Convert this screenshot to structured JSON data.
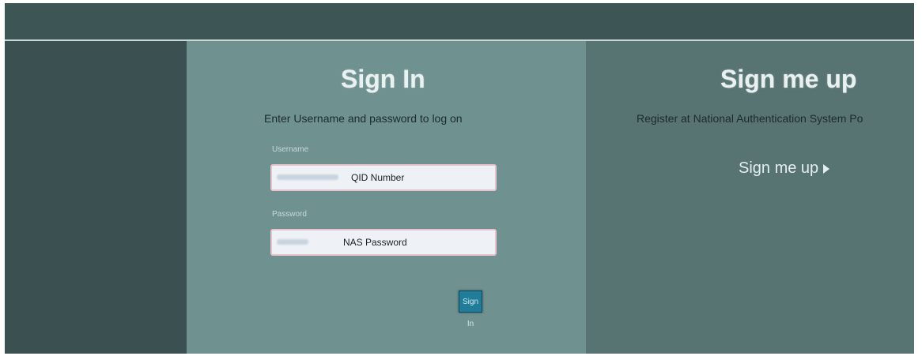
{
  "colors": {
    "dark_bg": "#3e5556",
    "signin_panel": "#6f9190",
    "signup_panel": "#577473",
    "button": "#1f7d9a"
  },
  "signin": {
    "title": "Sign In",
    "subtitle": "Enter Username and password to log on",
    "username_label": "Username",
    "username_placeholder": "QID Number",
    "password_label": "Password",
    "password_placeholder": "NAS Password",
    "button_label": "Sign In"
  },
  "signup": {
    "title": "Sign me up",
    "subtitle": "Register at National Authentication System Po",
    "link_label": "Sign me up",
    "link_icon": "arrow-right-icon"
  }
}
